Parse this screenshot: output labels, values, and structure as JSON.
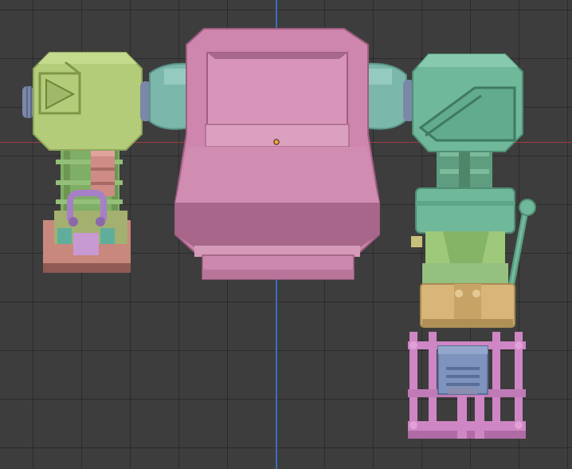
{
  "viewport": {
    "grid_visible": true,
    "colors": {
      "background": "#3d3d3d",
      "grid_line": "#2e2e2e",
      "axis_x": "#a33c3c",
      "axis_y": "#3b6fb8",
      "origin": "#f3a33a"
    }
  },
  "model": {
    "parts": [
      {
        "name": "left-shoulder-pod",
        "color": "#b3cc7a"
      },
      {
        "name": "right-shoulder-pod",
        "color": "#6fb89a"
      },
      {
        "name": "torso",
        "color": "#cf86ad"
      },
      {
        "name": "shoulder-joint",
        "color": "#7cb7ab"
      },
      {
        "name": "connector-bolt",
        "color": "#7b88a8"
      },
      {
        "name": "left-arm-gun",
        "color": "#cf8b85"
      },
      {
        "name": "left-arm-grip",
        "color": "#a77fc6"
      },
      {
        "name": "right-leg-knee",
        "color": "#d8b67a"
      },
      {
        "name": "right-foot-frame",
        "color": "#cf86c4"
      },
      {
        "name": "right-foot-core",
        "color": "#7e93bd"
      }
    ]
  }
}
